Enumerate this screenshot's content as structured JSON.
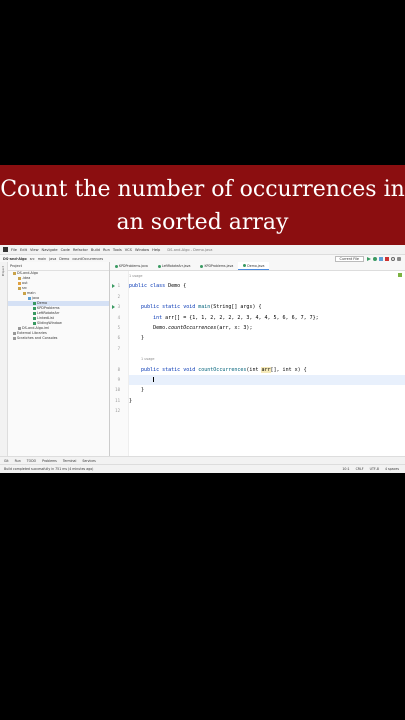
{
  "banner": {
    "line1": "Count the number of occurrences in",
    "line2": "an sorted array"
  },
  "ide": {
    "menu": [
      "File",
      "Edit",
      "View",
      "Navigate",
      "Code",
      "Refactor",
      "Build",
      "Run",
      "Tools",
      "VCS",
      "Window",
      "Help"
    ],
    "window_title": "DS-and-Algo - Demo.java",
    "breadcrumbs": [
      "DS-and-Algo",
      "src",
      "main",
      "java",
      "Demo",
      "countOccurrences"
    ],
    "run_config": "Current File",
    "project_label": "Project",
    "tree": [
      {
        "label": "DS-and-Algo",
        "indent": 1,
        "color": "#c9a34a"
      },
      {
        "label": ".idea",
        "indent": 2,
        "color": "#c9a34a"
      },
      {
        "label": "out",
        "indent": 2,
        "color": "#e0a040"
      },
      {
        "label": "src",
        "indent": 2,
        "color": "#c9a34a"
      },
      {
        "label": "main",
        "indent": 3,
        "color": "#c9a34a"
      },
      {
        "label": "java",
        "indent": 4,
        "color": "#5a9fd4"
      },
      {
        "label": "Demo",
        "indent": 5,
        "color": "#3a9a62",
        "selected": true
      },
      {
        "label": "KPDProblems",
        "indent": 5,
        "color": "#3a9a62"
      },
      {
        "label": "LeftRotateArr",
        "indent": 5,
        "color": "#3a9a62"
      },
      {
        "label": "LinkedList",
        "indent": 5,
        "color": "#3a9a62"
      },
      {
        "label": "SlidingWindow",
        "indent": 5,
        "color": "#3a9a62"
      },
      {
        "label": "DS-and-Algo.iml",
        "indent": 2,
        "color": "#999999"
      },
      {
        "label": "External Libraries",
        "indent": 1,
        "color": "#999999"
      },
      {
        "label": "Scratches and Consoles",
        "indent": 1,
        "color": "#999999"
      }
    ],
    "tabs": [
      {
        "label": "KPDProblems.java",
        "active": false
      },
      {
        "label": "LeftRotateArr.java",
        "active": false
      },
      {
        "label": "KPDProblems.java",
        "active": false
      },
      {
        "label": "Demo.java",
        "active": true
      }
    ],
    "code": {
      "usage_label": "1 usage",
      "usages_label": "1 usage",
      "class_kw": "public class",
      "class_name": "Demo {",
      "main_sig_kw": "public static void",
      "main_name": "main",
      "main_params": "(String[] args) {",
      "arr_line_kw": "int",
      "arr_line_rest": " arr[] = {1, 1, 2, 2, 2, 2, 3, 4, 4, 5, 6, 6, 7, 7};",
      "call_obj": "Demo.",
      "call_name": "countOccurrences",
      "call_args": "(arr, x: 3);",
      "close_brace": "}",
      "co_kw": "public static void",
      "co_name": "countOccurrences",
      "co_params_pre": "(int ",
      "co_params_arr": "arr",
      "co_params_post": "[], int x) {"
    },
    "bottom_tabs": [
      "Git",
      "Run",
      "TODO",
      "Problems",
      "Terminal",
      "Services"
    ],
    "status_text": "Build completed successfully in 751 ms (4 minutes ago)",
    "status_right": [
      "10:1",
      "CRLF",
      "UTF-8",
      "4 spaces"
    ]
  }
}
